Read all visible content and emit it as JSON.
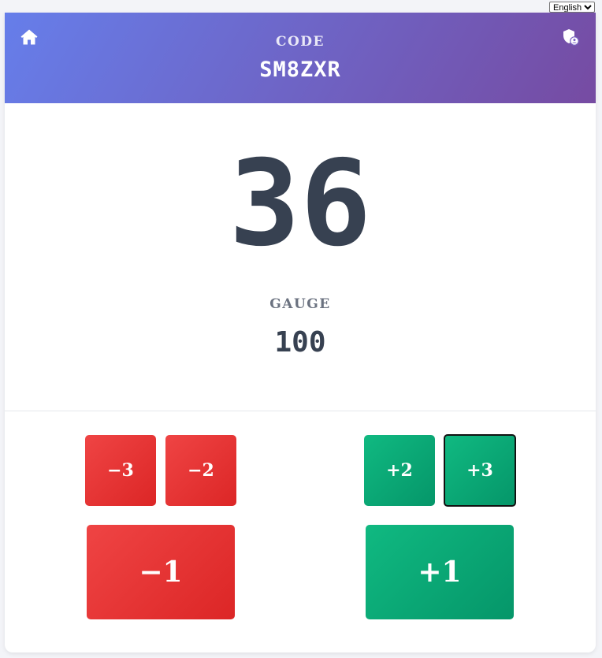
{
  "language": {
    "selected": "English"
  },
  "header": {
    "home_icon": "home-icon",
    "admin_icon": "admin-shield-icon",
    "code_label": "CODE",
    "code_value": "SM8ZXR",
    "gradient": [
      "#667eea",
      "#764ba2"
    ]
  },
  "scoreboard": {
    "score": "36",
    "gauge_label": "GAUGE",
    "gauge_value": "100"
  },
  "controls": {
    "minus3": "−3",
    "minus2": "−2",
    "plus2": "+2",
    "plus3": "+3",
    "minus1": "−1",
    "plus1": "+1",
    "negative_color": "#ef4444",
    "positive_color": "#10b981"
  }
}
